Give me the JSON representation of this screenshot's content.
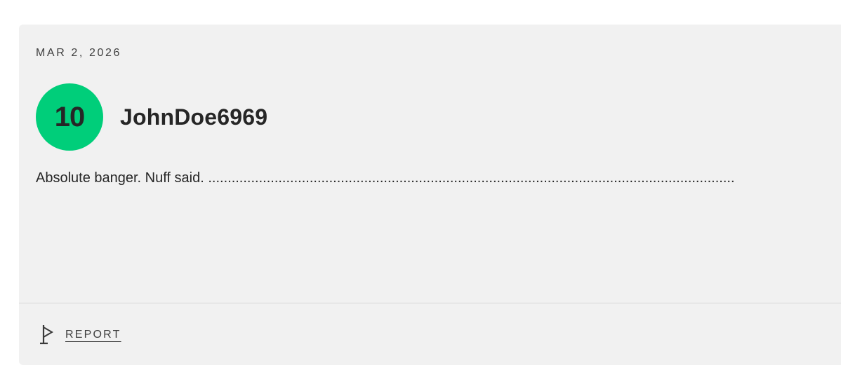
{
  "review": {
    "date": "MAR 2, 2026",
    "score": "10",
    "score_color": "#00ce7a",
    "username": "JohnDoe6969",
    "body": "Absolute banger. Nuff said. ......................................................................................................................................."
  },
  "footer": {
    "report_label": "REPORT",
    "report_icon": "flag-icon"
  }
}
